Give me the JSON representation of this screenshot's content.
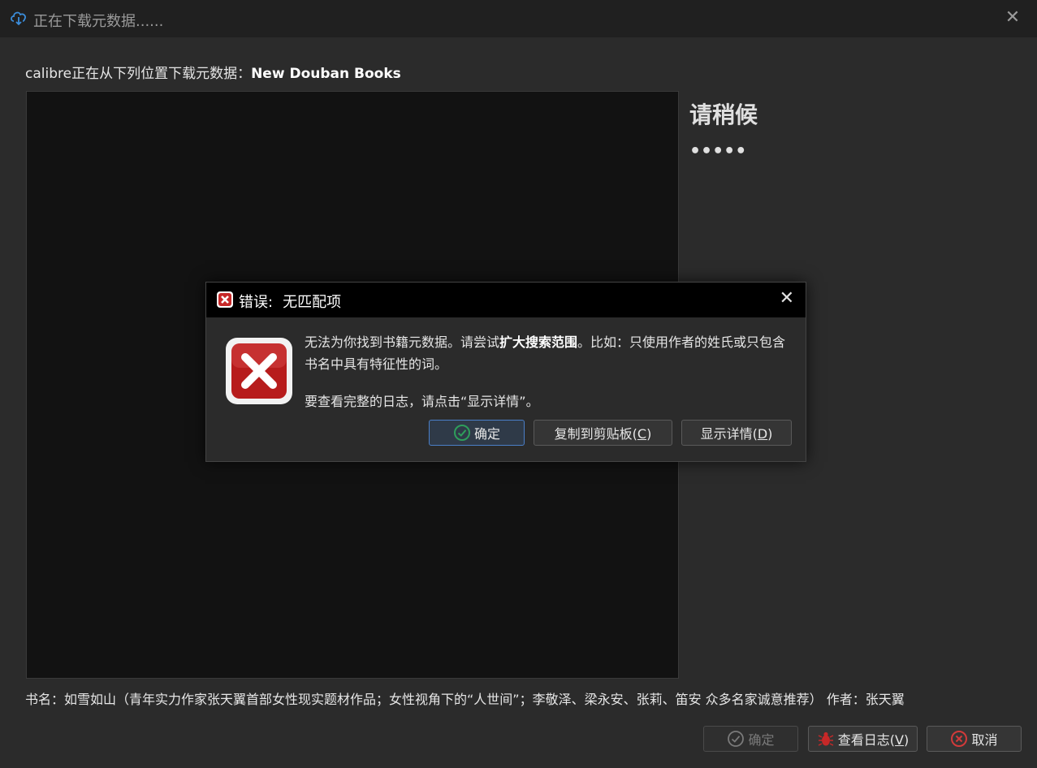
{
  "window": {
    "title": "正在下载元数据......",
    "close_glyph": "✕",
    "icon": "cloud-download-icon"
  },
  "source": {
    "prefix": "calibre正在从下列位置下载元数据：",
    "name": "New Douban Books"
  },
  "status": {
    "title": "请稍候",
    "dots": "•••••"
  },
  "book": {
    "info": "书名：如雪如山（青年实力作家张天翼首部女性现实题材作品；女性视角下的“人世间”；李敬泽、梁永安、张莉、笛安 众多名家诚意推荐） 作者：张天翼"
  },
  "footer": {
    "ok_label": "确定",
    "log_label_main": "查看日志(",
    "log_label_key": "V",
    "log_label_end": ")",
    "cancel_label": "取消"
  },
  "dialog": {
    "title_prefix": "错误:",
    "title_main": "无匹配项",
    "close_glyph": "✕",
    "message_part1": "无法为你找到书籍元数据。请尝试",
    "message_bold": "扩大搜索范围",
    "message_part2": "。比如：只使用作者的姓氏或只包含书名中具有特征性的词。",
    "message_log": "要查看完整的日志，请点击“显示详情”。",
    "ok_label": "确定",
    "copy_label_main": "复制到剪贴板(",
    "copy_label_key": "C",
    "copy_label_end": ")",
    "details_label_main": "显示详情(",
    "details_label_key": "D",
    "details_label_end": ")"
  },
  "colors": {
    "error_red": "#c62828",
    "ok_green": "#2e9e5b",
    "accent_blue": "#4a7fc8"
  }
}
